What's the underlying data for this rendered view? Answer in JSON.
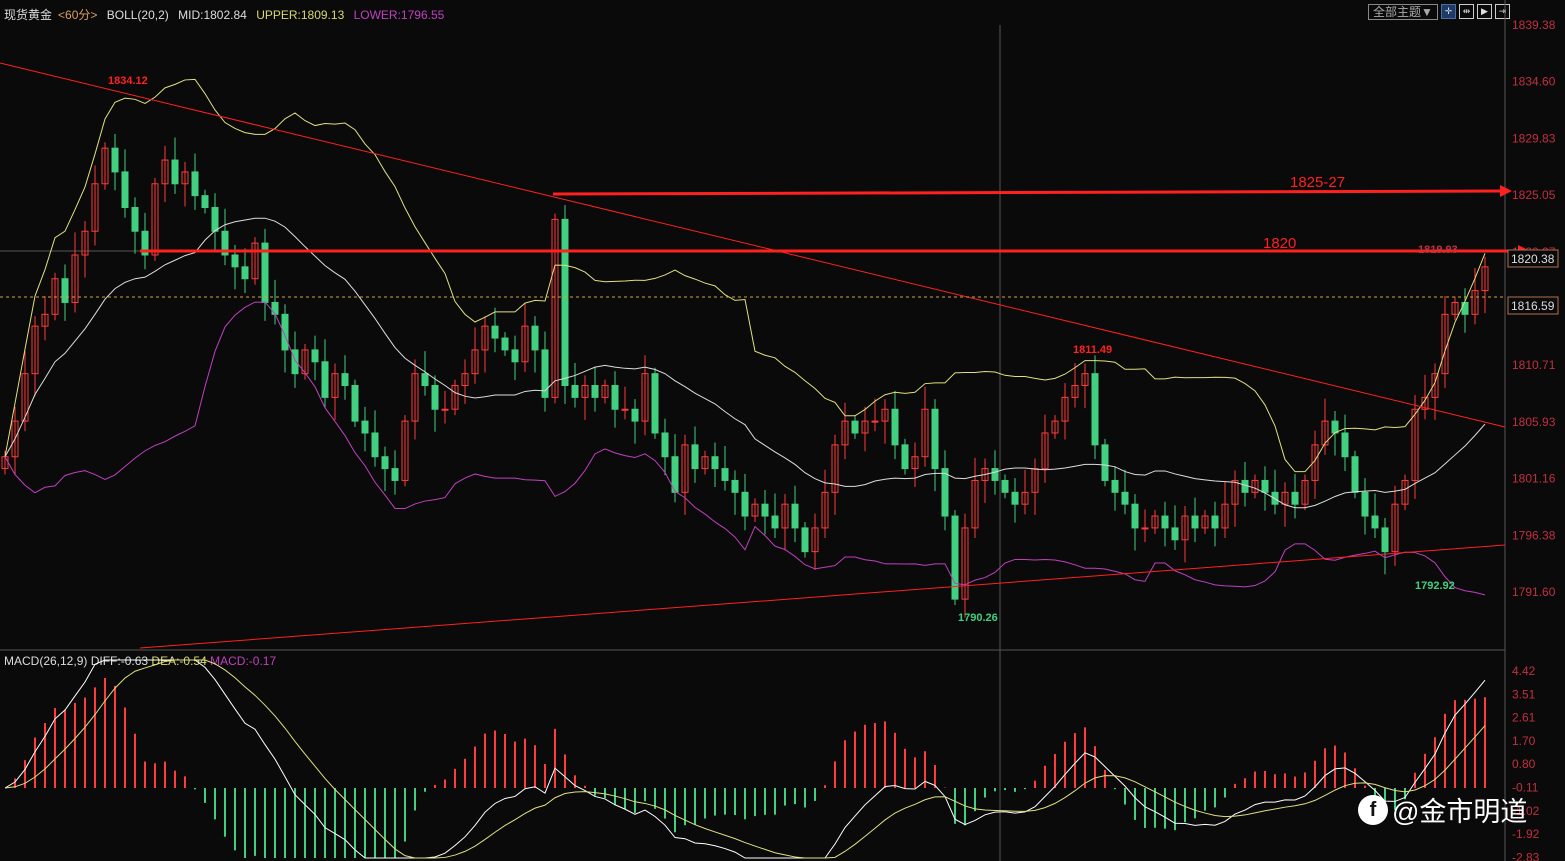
{
  "header": {
    "symbol": "现货黄金",
    "period": "<60分>",
    "indicator": "BOLL(20,2)",
    "mid": "MID:1802.84",
    "upper": "UPPER:1809.13",
    "lower": "LOWER:1796.55"
  },
  "macd_header": {
    "name": "MACD(26,12,9)",
    "diff": "DIFF:-0.63",
    "dea": "DEA:-0.54",
    "macd": "MACD:-0.17"
  },
  "toolbar": {
    "theme": "全部主题▼",
    "buttons": [
      "crosshair",
      "fit",
      "play",
      "end"
    ]
  },
  "watermark": "@金市明道",
  "colors": {
    "up": "#ff3b3b",
    "down": "#40d080",
    "axis": "#c03040",
    "trend": "#ff2020",
    "mid": "#ffffff",
    "upper": "#e0e080",
    "lower": "#c040c0"
  },
  "chart_data": {
    "type": "candlestick",
    "title": "现货黄金 60分",
    "ylim": [
      1791.6,
      1839.38
    ],
    "yticks": [
      "1839.38",
      "1834.60",
      "1829.83",
      "1825.05",
      "1820.27",
      "1815.49",
      "1810.71",
      "1805.93",
      "1801.16",
      "1796.38",
      "1791.60"
    ],
    "macd_ticks": [
      "4.42",
      "3.51",
      "2.61",
      "1.70",
      "0.80",
      "-0.11",
      "-1.02",
      "-1.92",
      "-2.83"
    ],
    "closes": [
      1803,
      1806,
      1810,
      1814,
      1815,
      1818,
      1816,
      1820,
      1822,
      1826,
      1829,
      1827,
      1824,
      1822,
      1820,
      1826,
      1828,
      1826,
      1827,
      1825,
      1824,
      1822,
      1820,
      1819,
      1818,
      1821,
      1816,
      1815,
      1812,
      1810,
      1812,
      1811,
      1808,
      1810,
      1809,
      1806,
      1805,
      1803,
      1802,
      1801,
      1806,
      1810,
      1809,
      1807,
      1807,
      1809,
      1810,
      1812,
      1814,
      1813,
      1812,
      1811,
      1814,
      1812,
      1808,
      1823,
      1809,
      1808,
      1809,
      1808,
      1809,
      1807,
      1807,
      1806,
      1810,
      1805,
      1803,
      1800,
      1804,
      1802,
      1803,
      1802,
      1801,
      1800,
      1798,
      1799,
      1798,
      1797,
      1799,
      1797,
      1795,
      1797,
      1800,
      1804,
      1806,
      1805,
      1806,
      1806,
      1807,
      1804,
      1802,
      1803,
      1807,
      1802,
      1798,
      1791,
      1797,
      1801,
      1802,
      1801,
      1800,
      1799,
      1800,
      1802,
      1805,
      1806,
      1808,
      1809,
      1810,
      1804,
      1801,
      1800,
      1799,
      1797,
      1797,
      1798,
      1797,
      1796,
      1798,
      1797,
      1798,
      1797,
      1799,
      1801,
      1800,
      1801,
      1800,
      1799,
      1800,
      1799,
      1801,
      1804,
      1806,
      1805,
      1803,
      1800,
      1798,
      1797,
      1795,
      1799,
      1801,
      1807,
      1808,
      1810,
      1815,
      1816,
      1815,
      1817,
      1819
    ],
    "annotations": {
      "high": "1834.12",
      "low": "1790.26",
      "swing_high": "1811.49",
      "recent_low": "1792.92",
      "line_label": "1819.93",
      "level_1820": "1820",
      "level_1825": "1825-27",
      "last_price": "1820.38",
      "dashed_price": "1816.59"
    }
  }
}
